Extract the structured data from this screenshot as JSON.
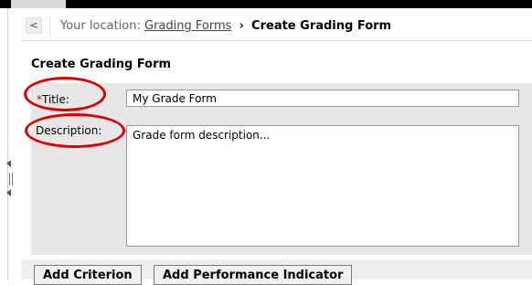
{
  "breadcrumb": {
    "back_label": "<",
    "prefix": "Your location:",
    "parent_link": "Grading Forms",
    "separator": "›",
    "current": "Create Grading Form"
  },
  "page": {
    "title": "Create Grading Form"
  },
  "form": {
    "title_required_marker": "*",
    "title_label": "Title:",
    "title_value": "My Grade Form",
    "description_label": "Description:",
    "description_value": "Grade form description..."
  },
  "actions": {
    "add_criterion": "Add Criterion",
    "add_performance_indicator": "Add Performance Indicator"
  },
  "colors": {
    "required": "#d00000",
    "annotation_circle": "#e00000",
    "panel_bg": "#e7e7e7"
  }
}
